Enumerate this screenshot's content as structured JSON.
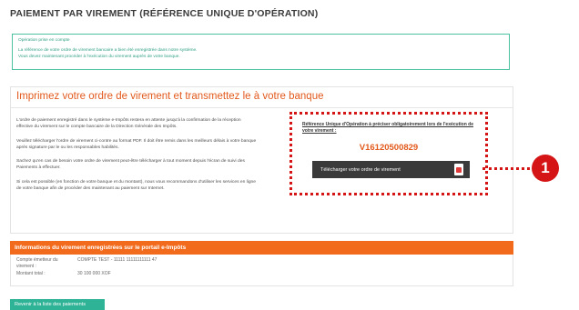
{
  "page": {
    "title": "PAIEMENT PAR VIREMENT (RÉFÉRENCE UNIQUE D'OPÉRATION)"
  },
  "confirmation": {
    "title": "Opération prise en compte",
    "line1": "La référence de votre ordre de virement bancaire a bien été enregistrée dans notre système.",
    "line2": "Vous devez maintenant procéder à l'exécution du virement auprès de votre banque."
  },
  "main": {
    "heading": "Imprimez votre ordre de virement et transmettez le à votre banque",
    "paragraphs": [
      "L'ordre de paiement enregistré dans le système e-Impôts restera en attente jusqu'à la confirmation de la réception effective du virement sur le compte bancaire de la Direction Générale des Impôts.",
      "Veuillez télécharger l'ordre de virement ci-contre au format PDF. Il doit être remis dans les meilleurs délais à votre banque après signature par le ou les responsables habilités.",
      "Sachez qu'en cas de besoin votre ordre de virement peut-être télécharger à tout moment depuis l'écran de suivi des Paiements à effectuer.",
      "Si cela est possible (en fonction de votre banque et du montant), nous vous recommandons d'utiliser les services en ligne de votre banque afin de procéder des maintenant au paiement sur Internet."
    ],
    "reference_label": "Référence Unique d'Opération à préciser obligatoirement lors de l'exécution de votre virement :",
    "reference_number": "V16120500829",
    "download_label": "Télécharger votre ordre de virement"
  },
  "callout": {
    "number": "1"
  },
  "info": {
    "header": "Informations du virement enregistrées sur le portail e-Impôts",
    "rows": [
      {
        "label": "Compte émetteur du virement :",
        "value": "COMPTE TEST - 11111 11111111111 47"
      },
      {
        "label": "Montant total :",
        "value": "30 100 000 XOF"
      }
    ]
  },
  "footer": {
    "back_label": "Revenir à la liste des paiements"
  },
  "colors": {
    "accent_orange": "#f26b1d",
    "accent_green": "#2fb396",
    "callout_red": "#d51515"
  },
  "icons": [
    "pdf-icon"
  ]
}
